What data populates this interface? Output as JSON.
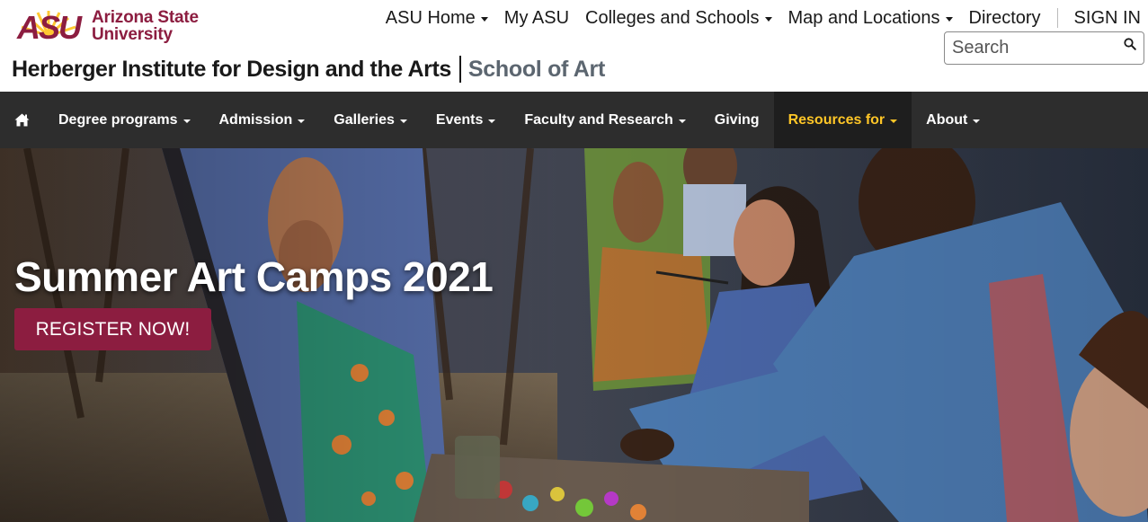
{
  "logo": {
    "mark": "ASU",
    "line1": "Arizona State",
    "line2": "University"
  },
  "universal_nav": {
    "items": [
      {
        "label": "ASU Home",
        "dropdown": true
      },
      {
        "label": "My ASU",
        "dropdown": false
      },
      {
        "label": "Colleges and Schools",
        "dropdown": true
      },
      {
        "label": "Map and Locations",
        "dropdown": true
      },
      {
        "label": "Directory",
        "dropdown": false
      }
    ],
    "sign_in": "SIGN IN"
  },
  "search": {
    "placeholder": "Search",
    "icon": "search-icon"
  },
  "site_title": {
    "parent_unit": "Herberger Institute for Design and the Arts",
    "subunit": "School of Art"
  },
  "site_nav": {
    "home_icon": "home-icon",
    "items": [
      {
        "label": "Degree programs",
        "dropdown": true,
        "active": false
      },
      {
        "label": "Admission",
        "dropdown": true,
        "active": false
      },
      {
        "label": "Galleries",
        "dropdown": true,
        "active": false
      },
      {
        "label": "Events",
        "dropdown": true,
        "active": false
      },
      {
        "label": "Faculty and Research",
        "dropdown": true,
        "active": false
      },
      {
        "label": "Giving",
        "dropdown": false,
        "active": false
      },
      {
        "label": "Resources for",
        "dropdown": true,
        "active": true
      },
      {
        "label": "About",
        "dropdown": true,
        "active": false
      }
    ]
  },
  "hero": {
    "title": "Summer Art Camps 2021",
    "button_label": "REGISTER NOW!"
  },
  "colors": {
    "maroon": "#8c1d40",
    "gold": "#ffc627",
    "nav_bg": "#2d2d2d",
    "nav_active_bg": "#1e1e1e"
  }
}
